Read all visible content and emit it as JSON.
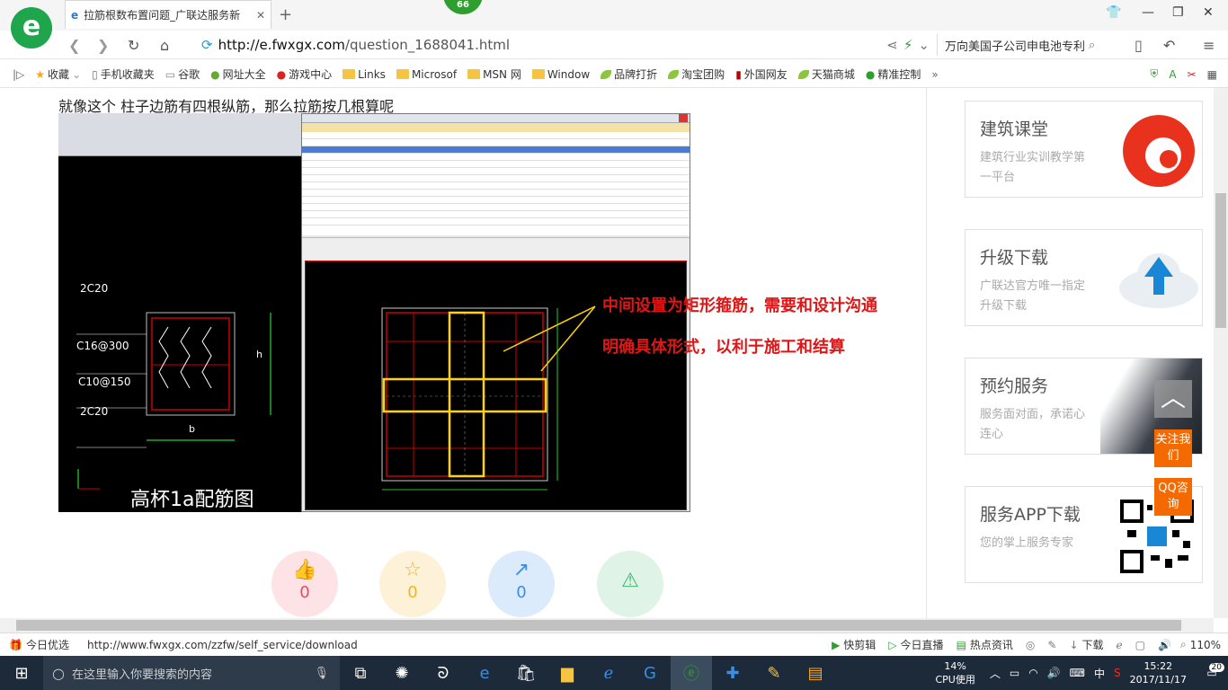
{
  "browser": {
    "tab_title": "拉筋根数布置问题_广联达服务新",
    "badge": "66",
    "url_host": "http://e.fwxgx.com",
    "url_path": "/question_1688041.html",
    "search_text": "万向美国子公司申电池专利"
  },
  "bookmarks": [
    {
      "label": "收藏",
      "icon": "star-icon"
    },
    {
      "label": "手机收藏夹",
      "icon": "phone-icon"
    },
    {
      "label": "谷歌",
      "icon": "page-icon"
    },
    {
      "label": "网址大全",
      "icon": "globe-icon"
    },
    {
      "label": "游戏中心",
      "icon": "game-icon"
    },
    {
      "label": "Links",
      "icon": "folder-icon"
    },
    {
      "label": "Microsof",
      "icon": "folder-icon"
    },
    {
      "label": "MSN 网",
      "icon": "folder-icon"
    },
    {
      "label": "Window",
      "icon": "folder-icon"
    },
    {
      "label": "品牌打折",
      "icon": "leaf-icon"
    },
    {
      "label": "淘宝团购",
      "icon": "leaf-icon"
    },
    {
      "label": "外国网友",
      "icon": "flag-icon"
    },
    {
      "label": "天猫商城",
      "icon": "leaf-icon"
    },
    {
      "label": "精准控制",
      "icon": "chat-icon"
    }
  ],
  "question": {
    "text": "就像这个  柱子边筋有四根纵筋，那么拉筋按几根算呢"
  },
  "drawing": {
    "labels": [
      "2C20",
      "C16@300",
      "C10@150",
      "2C20"
    ],
    "dim_b": "b",
    "dim_h": "h",
    "caption": "高杯1a配筋图",
    "annotation_line1": "中间设置为矩形箍筋，需要和设计沟通",
    "annotation_line2": "明确具体形式，以利于施工和结算"
  },
  "rating": [
    {
      "icon": "thumbs-up-icon",
      "value": "0",
      "color": "#e84a5f",
      "bg": "#fde3e6"
    },
    {
      "icon": "star-icon",
      "value": "0",
      "color": "#f0b429",
      "bg": "#fdf1d8"
    },
    {
      "icon": "share-icon",
      "value": "0",
      "color": "#3a8ee6",
      "bg": "#dcebfb"
    },
    {
      "icon": "warning-icon",
      "value": "",
      "color": "#3bb56a",
      "bg": "#dff4e7"
    }
  ],
  "sidebar": {
    "cards": [
      {
        "title": "建筑课堂",
        "sub": "建筑行业实训教学第一平台"
      },
      {
        "title": "升级下载",
        "sub": "广联达官方唯一指定升级下载"
      },
      {
        "title": "预约服务",
        "sub": "服务面对面，承诺心连心"
      },
      {
        "title": "服务APP下载",
        "sub": "您的掌上服务专家"
      }
    ],
    "float_follow": "关注我们",
    "float_qq": "QQ咨询"
  },
  "status_bar": {
    "left_label": "今日优选",
    "url": "http://www.fwxgx.com/zzfw/self_service/download",
    "items": [
      "快剪辑",
      "今日直播",
      "热点资讯"
    ],
    "download": "下载",
    "zoom": "110%"
  },
  "taskbar": {
    "search_placeholder": "在这里输入你要搜索的内容",
    "cpu_percent": "14%",
    "cpu_label": "CPU使用",
    "ime": "中",
    "time": "15:22",
    "date": "2017/11/17",
    "notif_count": "20"
  }
}
